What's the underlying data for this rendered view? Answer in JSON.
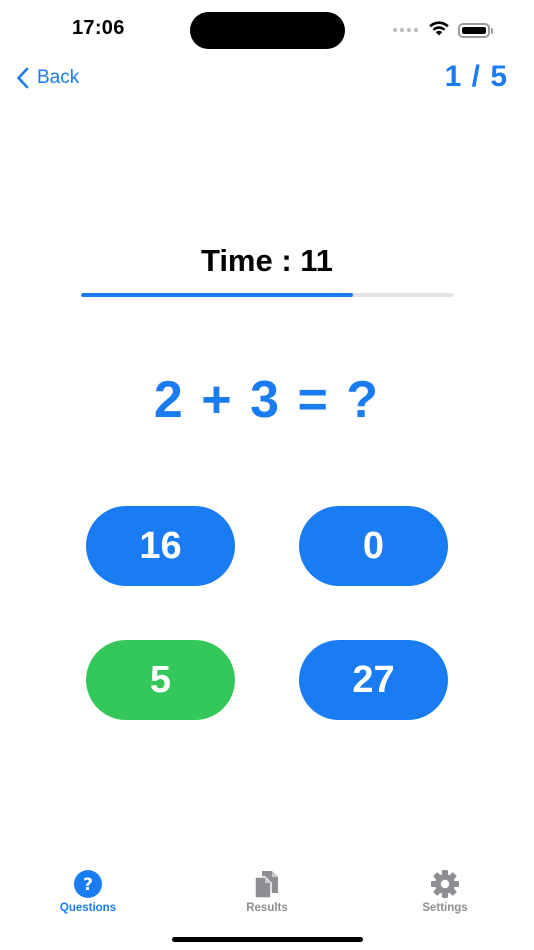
{
  "status_bar": {
    "time": "17:06"
  },
  "nav": {
    "back_label": "Back",
    "progress": "1 / 5"
  },
  "timer": {
    "label": "Time : 11",
    "remaining_fraction": 0.73
  },
  "question": {
    "text": "2 + 3 = ?"
  },
  "answers": [
    {
      "value": "16",
      "state": "default"
    },
    {
      "value": "0",
      "state": "default"
    },
    {
      "value": "5",
      "state": "correct"
    },
    {
      "value": "27",
      "state": "default"
    }
  ],
  "tab_bar": {
    "tabs": [
      {
        "label": "Questions",
        "icon": "question-circle-icon",
        "active": true
      },
      {
        "label": "Results",
        "icon": "documents-icon",
        "active": false
      },
      {
        "label": "Settings",
        "icon": "gear-icon",
        "active": false
      }
    ]
  },
  "colors": {
    "accent": "#1a7cf3",
    "correct": "#34c759",
    "inactive": "#8e8e93"
  }
}
